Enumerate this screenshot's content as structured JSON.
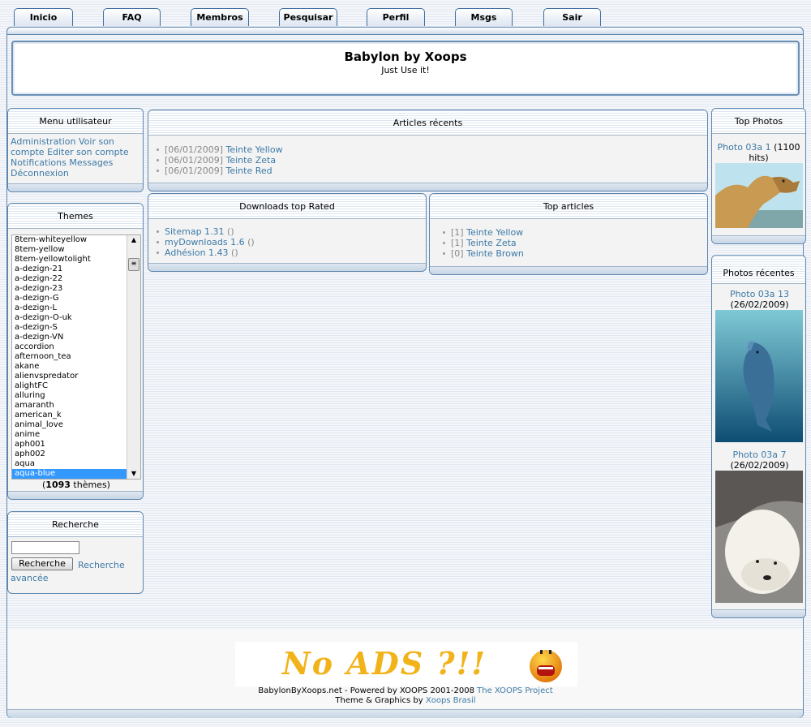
{
  "nav": {
    "tabs": [
      "Inicio",
      "FAQ",
      "Membros",
      "Pesquisar",
      "Perfil",
      "Msgs",
      "Sair"
    ]
  },
  "header": {
    "title": "Babylon by Xoops",
    "subtitle": "Just Use it!"
  },
  "user_menu": {
    "title": "Menu utilisateur",
    "links": [
      "Administration",
      "Voir son compte",
      "Editer son compte",
      "Notifications",
      "Messages",
      "Déconnexion"
    ]
  },
  "themes": {
    "title": "Themes",
    "items": [
      "8tem-whiteyellow",
      "8tem-yellow",
      "8tem-yellowtolight",
      "a-dezign-21",
      "a-dezign-22",
      "a-dezign-23",
      "a-dezign-G",
      "a-dezign-L",
      "a-dezign-O-uk",
      "a-dezign-S",
      "a-dezign-VN",
      "accordion",
      "afternoon_tea",
      "akane",
      "alienvspredator",
      "alightFC",
      "alluring",
      "amaranth",
      "american_k",
      "animal_love",
      "anime",
      "aph001",
      "aph002",
      "aqua",
      "aqua-blue"
    ],
    "selected": "aqua-blue",
    "count_prefix": "(",
    "count": "1093",
    "count_suffix": " thèmes)"
  },
  "search": {
    "title": "Recherche",
    "button": "Recherche",
    "advanced": "Recherche avancée"
  },
  "recent_articles": {
    "title": "Articles récents",
    "items": [
      {
        "date": "[06/01/2009]",
        "title": "Teinte Yellow"
      },
      {
        "date": "[06/01/2009]",
        "title": "Teinte Zeta"
      },
      {
        "date": "[06/01/2009]",
        "title": "Teinte Red"
      }
    ]
  },
  "downloads": {
    "title": "Downloads top Rated",
    "items": [
      {
        "name": "Sitemap 1.31",
        "extra": " ()"
      },
      {
        "name": "myDownloads 1.6",
        "extra": " ()"
      },
      {
        "name": "Adhésion 1.43",
        "extra": " ()"
      }
    ]
  },
  "top_articles": {
    "title": "Top articles",
    "items": [
      {
        "count": "[1]",
        "title": "Teinte Yellow"
      },
      {
        "count": "[1]",
        "title": "Teinte Zeta"
      },
      {
        "count": "[0]",
        "title": "Teinte Brown"
      }
    ]
  },
  "top_photos": {
    "title": "Top Photos",
    "photo_link": "Photo 03a 1",
    "hits": " (1100 hits)"
  },
  "recent_photos": {
    "title": "Photos récentes",
    "photos": [
      {
        "link": "Photo 03a 13",
        "date": "(26/02/2009)"
      },
      {
        "link": "Photo 03a 7",
        "date": "(26/02/2009)"
      }
    ]
  },
  "footer": {
    "ad_text": "No ADS ?!!",
    "line1_text": "BabylonByXoops.net - Powered by XOOPS 2001-2008 ",
    "line1_link": "The XOOPS Project",
    "line2_text": "Theme & Graphics by ",
    "line2_link": "Xoops Brasil"
  },
  "colors": {
    "link": "#3d7aa6",
    "border": "#5d86ad",
    "selection": "#3399ff"
  }
}
